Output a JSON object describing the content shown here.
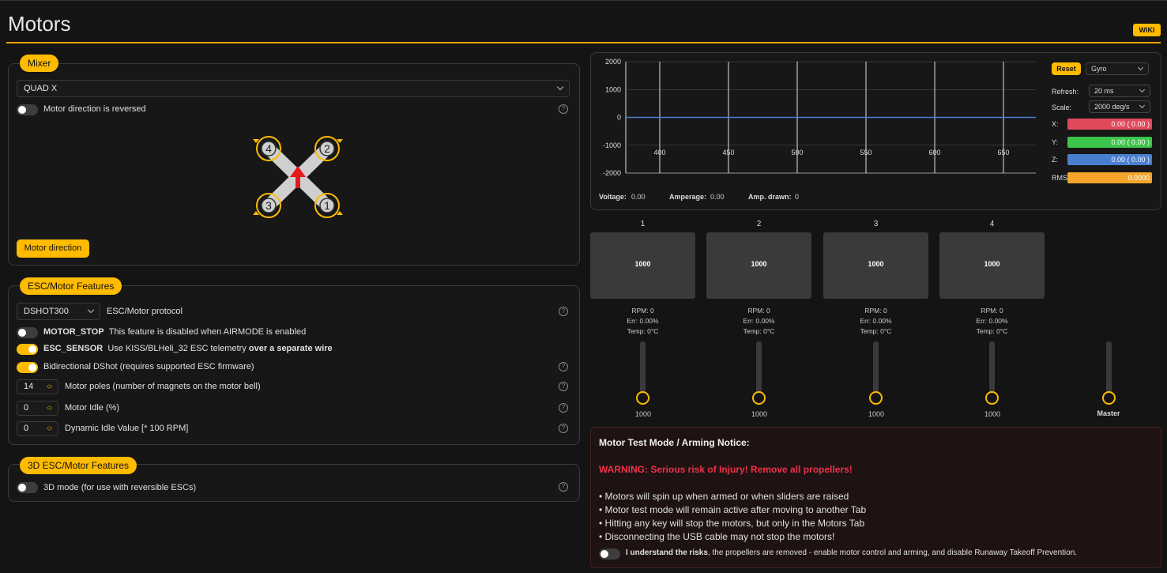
{
  "header": {
    "title": "Motors",
    "wiki_label": "WIKI"
  },
  "mixer": {
    "title": "Mixer",
    "selected": "QUAD X",
    "reversed_label": "Motor direction is reversed",
    "reversed_on": false,
    "motor_direction_button": "Motor direction",
    "diagram_motors": [
      "4",
      "2",
      "3",
      "1"
    ]
  },
  "esc": {
    "title": "ESC/Motor Features",
    "protocol": "DSHOT300",
    "protocol_label": "ESC/Motor protocol",
    "motor_stop_name": "MOTOR_STOP",
    "motor_stop_desc": "This feature is disabled when AIRMODE is enabled",
    "esc_sensor_name": "ESC_SENSOR",
    "esc_sensor_desc": "Use KISS/BLHeli_32 ESC telemetry",
    "esc_sensor_bold": "over a separate wire",
    "bidir_label": "Bidirectional DShot (requires supported ESC firmware)",
    "poles_value": "14",
    "poles_label": "Motor poles (number of magnets on the motor bell)",
    "idle_value": "0",
    "idle_label": "Motor Idle (%)",
    "dyn_idle_value": "0",
    "dyn_idle_label": "Dynamic Idle Value [* 100 RPM]"
  },
  "esc3d": {
    "title": "3D ESC/Motor Features",
    "mode_label": "3D mode (for use with reversible ESCs)"
  },
  "sensor": {
    "reset_label": "Reset",
    "type": "Gyro",
    "refresh_label": "Refresh:",
    "refresh_value": "20 ms",
    "scale_label": "Scale:",
    "scale_value": "2000 deg/s",
    "x_label": "X:",
    "x_value": "0.00 ( 0.00 )",
    "y_label": "Y:",
    "y_value": "0.00 ( 0.00 )",
    "z_label": "Z:",
    "z_value": "0.00 ( 0.00 )",
    "rms_label": "RMS:",
    "rms_value": "0.0000",
    "voltage_label": "Voltage:",
    "voltage_value": "0.00",
    "amperage_label": "Amperage:",
    "amperage_value": "0.00",
    "drawn_label": "Amp. drawn:",
    "drawn_value": "0",
    "colors": {
      "x": "#e04a5c",
      "y": "#3cc44a",
      "z": "#4a7fd0",
      "rms": "#f4a52a"
    }
  },
  "chart_data": {
    "type": "line",
    "ylim": [
      -2000,
      2000
    ],
    "y_ticks": [
      "2000",
      "1000",
      "0",
      "-1000",
      "-2000"
    ],
    "x_ticks": [
      "400",
      "450",
      "500",
      "550",
      "600",
      "650"
    ],
    "series": [
      {
        "values": [
          0,
          0,
          0,
          0,
          0,
          0
        ]
      }
    ]
  },
  "motors": [
    {
      "num": "1",
      "value": "1000",
      "rpm": "RPM: 0",
      "err": "Err: 0.00%",
      "temp": "Temp: 0°C",
      "slider": "1000"
    },
    {
      "num": "2",
      "value": "1000",
      "rpm": "RPM: 0",
      "err": "Err: 0.00%",
      "temp": "Temp: 0°C",
      "slider": "1000"
    },
    {
      "num": "3",
      "value": "1000",
      "rpm": "RPM: 0",
      "err": "Err: 0.00%",
      "temp": "Temp: 0°C",
      "slider": "1000"
    },
    {
      "num": "4",
      "value": "1000",
      "rpm": "RPM: 0",
      "err": "Err: 0.00%",
      "temp": "Temp: 0°C",
      "slider": "1000"
    }
  ],
  "master_label": "Master",
  "notice": {
    "title": "Motor Test Mode / Arming Notice:",
    "warning": "WARNING: Serious risk of Injury! Remove all propellers!",
    "bullets": [
      "• Motors will spin up when armed or when sliders are raised",
      "• Motor test mode will remain active after moving to another Tab",
      "• Hitting any key will stop the motors, but only in the Motors Tab",
      "• Disconnecting the USB cable may not stop the motors!"
    ],
    "understand_bold": "I understand the risks",
    "understand_rest": ", the propellers are removed - enable motor control and arming, and disable Runaway Takeoff Prevention."
  }
}
